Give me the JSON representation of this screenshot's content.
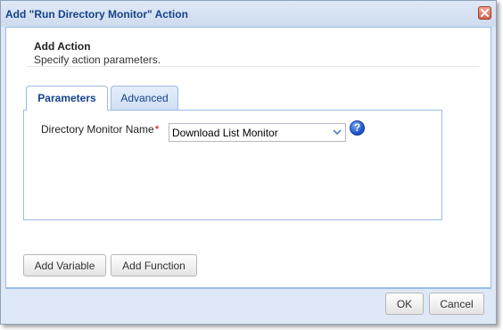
{
  "window": {
    "title": "Add \"Run Directory Monitor\" Action"
  },
  "header": {
    "title": "Add Action",
    "subtitle": "Specify action parameters."
  },
  "tabs": [
    {
      "label": "Parameters",
      "active": true
    },
    {
      "label": "Advanced",
      "active": false
    }
  ],
  "form": {
    "directory_monitor": {
      "label": "Directory Monitor Name",
      "required_mark": "*",
      "value": "Download List Monitor"
    },
    "help_symbol": "?"
  },
  "buttons": {
    "add_variable": "Add Variable",
    "add_function": "Add Function",
    "ok": "OK",
    "cancel": "Cancel"
  },
  "icons": {
    "close": "close-icon",
    "dropdown": "chevron-down-icon",
    "help": "help-icon"
  },
  "colors": {
    "title_text": "#15428b",
    "panel_bg": "#dfe8f6",
    "border": "#99bbe8",
    "required": "#cc0000"
  }
}
